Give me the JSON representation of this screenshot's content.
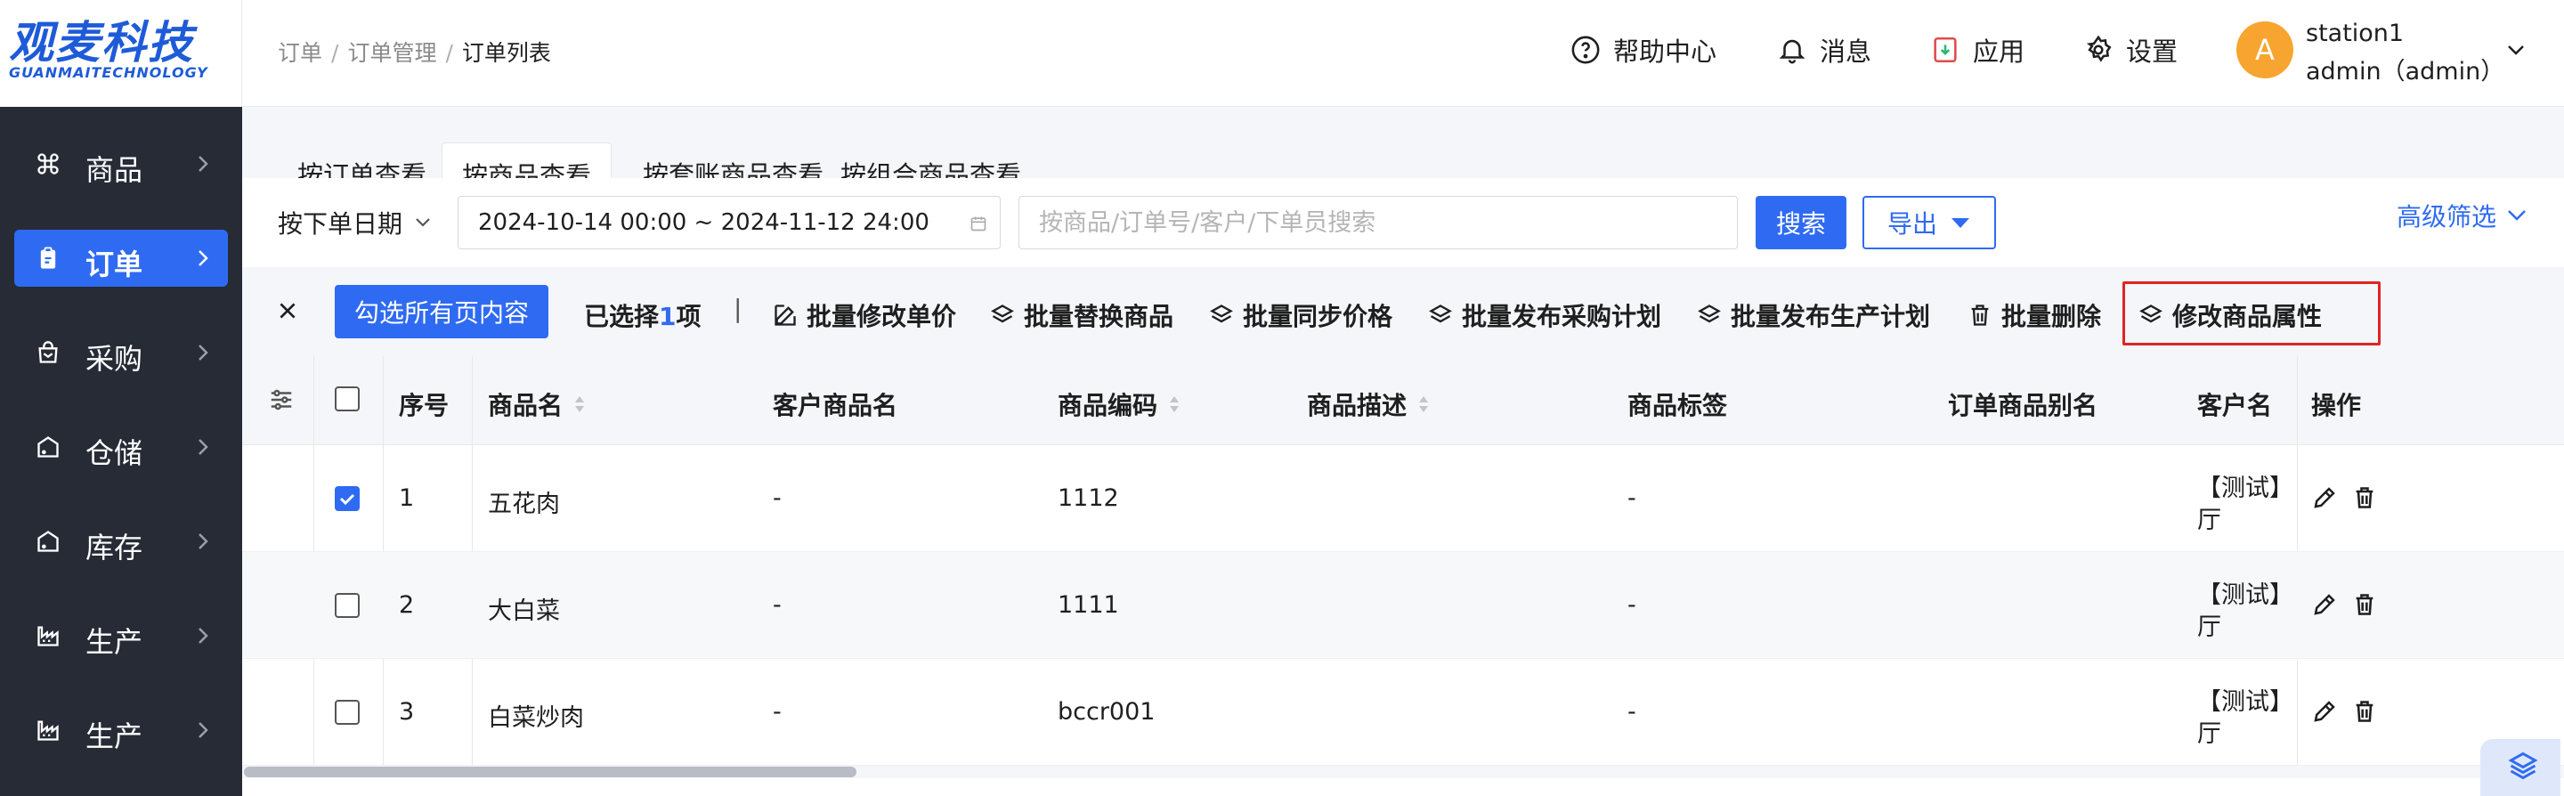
{
  "logo": {
    "main": "观麦科技",
    "sub": "GUANMAITECHNOLOGY",
    "color": "#1e5bd8"
  },
  "sidebar": {
    "items": [
      {
        "label": "商品",
        "icon": "command-icon",
        "active": false
      },
      {
        "label": "订单",
        "icon": "clipboard-icon",
        "active": true
      },
      {
        "label": "采购",
        "icon": "shopping-bag-icon",
        "active": false
      },
      {
        "label": "仓储",
        "icon": "warehouse-icon",
        "active": false
      },
      {
        "label": "库存",
        "icon": "warehouse-icon",
        "active": false
      },
      {
        "label": "生产",
        "icon": "factory-icon",
        "active": false
      },
      {
        "label": "生产",
        "icon": "factory-icon",
        "active": false
      }
    ]
  },
  "header": {
    "breadcrumb": [
      "订单",
      "订单管理",
      "订单列表"
    ],
    "help": "帮助中心",
    "messages": "消息",
    "apps": "应用",
    "settings": "设置",
    "avatar_letter": "A",
    "user_name": "station1",
    "user_role": "admin（admin）"
  },
  "tabs": [
    "按订单查看",
    "按商品查看",
    "按套账商品查看",
    "按组合商品查看"
  ],
  "filter": {
    "date_type": "按下单日期",
    "date_range": "2024-10-14 00:00 ~ 2024-11-12 24:00",
    "search_placeholder": "按商品/订单号/客户/下单员搜索",
    "search_button": "搜索",
    "export_button": "导出",
    "advanced_filter": "高级筛选"
  },
  "batch": {
    "select_all": "勾选所有页内容",
    "selected_prefix": "已选择",
    "selected_count": "1",
    "selected_suffix": "项",
    "divider": "|",
    "actions": [
      "批量修改单价",
      "批量替换商品",
      "批量同步价格",
      "批量发布采购计划",
      "批量发布生产计划",
      "批量删除",
      "修改商品属性"
    ]
  },
  "table": {
    "headers": [
      "序号",
      "商品名",
      "客户商品名",
      "商品编码",
      "商品描述",
      "商品标签",
      "订单商品别名",
      "客户名",
      "操作"
    ],
    "rows": [
      {
        "index": "1",
        "name": "五花肉",
        "customer_name": "-",
        "code": "1112",
        "desc": "",
        "tag": "-",
        "alias": "",
        "customer_line1": "【测试】",
        "customer_line2": "厅",
        "checked": true
      },
      {
        "index": "2",
        "name": "大白菜",
        "customer_name": "-",
        "code": "1111",
        "desc": "",
        "tag": "-",
        "alias": "",
        "customer_line1": "【测试】",
        "customer_line2": "厅",
        "checked": false
      },
      {
        "index": "3",
        "name": "白菜炒肉",
        "customer_name": "-",
        "code": "bccr001",
        "desc": "",
        "tag": "-",
        "alias": "",
        "customer_line1": "【测试】",
        "customer_line2": "厅",
        "checked": false
      }
    ]
  },
  "colors": {
    "accent": "#2f6bf2",
    "sidebar_bg": "#262b36",
    "highlight": "#e02424",
    "avatar": "#f7a530"
  }
}
